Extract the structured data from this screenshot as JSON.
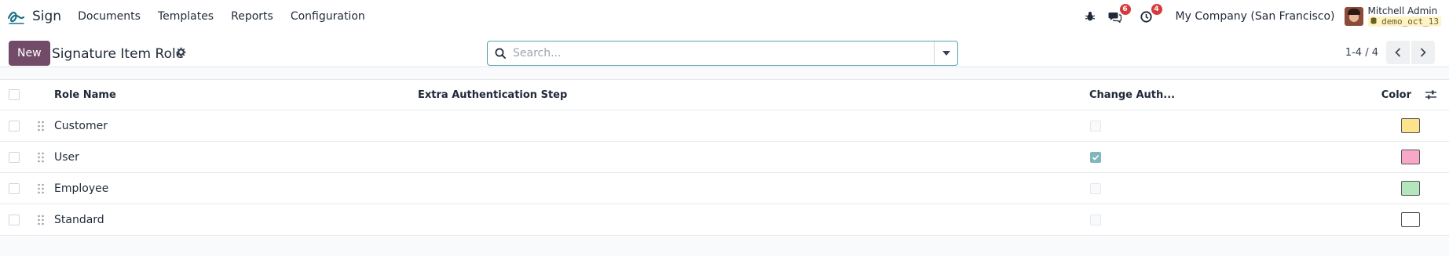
{
  "navbar": {
    "app_name": "Sign",
    "menu": [
      "Documents",
      "Templates",
      "Reports",
      "Configuration"
    ],
    "messages_badge": "6",
    "activities_badge": "4",
    "company": "My Company (San Francisco)",
    "user_name": "Mitchell Admin",
    "database": "demo_oct_13"
  },
  "control": {
    "new_label": "New",
    "title": "Signature Item Role",
    "search_placeholder": "Search...",
    "pager": "1-4 / 4"
  },
  "table": {
    "headers": {
      "name": "Role Name",
      "extra": "Extra Authentication Step",
      "change": "Change Auth...",
      "color": "Color"
    },
    "rows": [
      {
        "name": "Customer",
        "change_auth": false,
        "color": "#fde38c"
      },
      {
        "name": "User",
        "change_auth": true,
        "color": "#f7a8c8"
      },
      {
        "name": "Employee",
        "change_auth": false,
        "color": "#b5e5bd"
      },
      {
        "name": "Standard",
        "change_auth": false,
        "color": "#ffffff"
      }
    ]
  },
  "colors": {
    "brand": "#714b67",
    "search_border": "#52a3ad",
    "badge": "#d63b3b"
  }
}
